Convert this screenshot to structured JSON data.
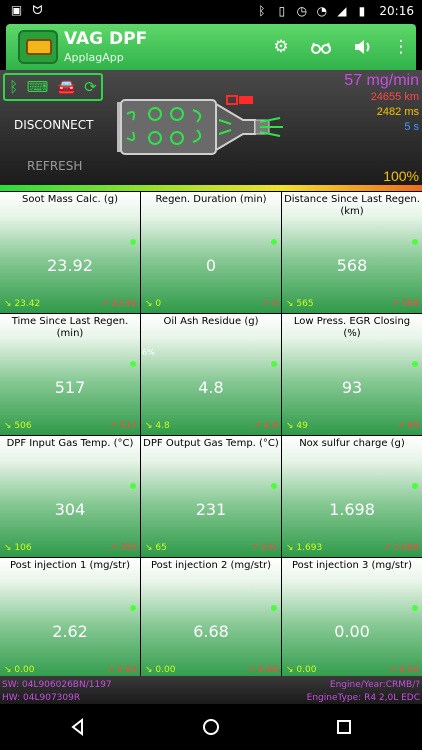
{
  "statusbar": {
    "time": "20:16",
    "left_icons": [
      "image-icon",
      "cat-icon"
    ],
    "right_icons": [
      "bluetooth-icon",
      "vibrate-icon",
      "alarm-icon",
      "wifi-icon",
      "signal-icon",
      "battery-icon"
    ]
  },
  "appbar": {
    "title": "VAG DPF",
    "subtitle": "ApplagApp",
    "actions": [
      "gear-icon",
      "glasses-icon",
      "volume-icon",
      "more-icon"
    ]
  },
  "header": {
    "status_icons": [
      "bluetooth-icon",
      "obd-adapter-icon",
      "car-icon",
      "refresh-icon"
    ],
    "disconnect_label": "DISCONNECT",
    "refresh_label": "REFRESH",
    "flow_rate": "57 mg/min",
    "distance": "24655 km",
    "duration_ms": "2482 ms",
    "seconds": "5 s",
    "fill_percent": "100%",
    "fill_fraction": 1.0
  },
  "tiles": [
    {
      "title": "Soot Mass Calc. (g)",
      "value": "23.92",
      "min": "23.42",
      "max": "23.92"
    },
    {
      "title": "Regen. Duration (min)",
      "value": "0",
      "min": "0",
      "max": "0"
    },
    {
      "title": "Distance Since Last Regen. (km)",
      "value": "568",
      "min": "565",
      "max": "568"
    },
    {
      "title": "Time Since Last Regen. (min)",
      "value": "517",
      "min": "506",
      "max": "517"
    },
    {
      "title": "Oil Ash Residue (g)",
      "value": "4.8",
      "min": "4.8",
      "max": "4.8",
      "tagline": "6%"
    },
    {
      "title": "Low Press. EGR Closing (%)",
      "value": "93",
      "min": "49",
      "max": "99"
    },
    {
      "title": "DPF Input Gas Temp. (°C)",
      "value": "304",
      "min": "106",
      "max": "355"
    },
    {
      "title": "DPF Output Gas Temp. (°C)",
      "value": "231",
      "min": "65",
      "max": "231"
    },
    {
      "title": "Nox sulfur charge (g)",
      "value": "1.698",
      "min": "1.693",
      "max": "1.698"
    },
    {
      "title": "Post injection 1 (mg/str)",
      "value": "2.62",
      "min": "0.00",
      "max": "2.62"
    },
    {
      "title": "Post injection 2 (mg/str)",
      "value": "6.68",
      "min": "0.00",
      "max": "6.68"
    },
    {
      "title": "Post injection 3 (mg/str)",
      "value": "0.00",
      "min": "0.00",
      "max": "0.00"
    }
  ],
  "footer": {
    "sw": "SW: 04L906026BN/1197",
    "hw": "HW: 04L907309R",
    "engine_year": "Engine/Year:CRMB/?",
    "engine_type": "EngineType: R4 2,0L EDC"
  },
  "navbar": {
    "buttons": [
      "back-icon",
      "home-icon",
      "recents-icon"
    ]
  },
  "colors": {
    "accent": "#31b34a",
    "flow": "#c64fe0",
    "distance": "#ff4646",
    "duration": "#f8c200",
    "seconds": "#3d9cff"
  }
}
